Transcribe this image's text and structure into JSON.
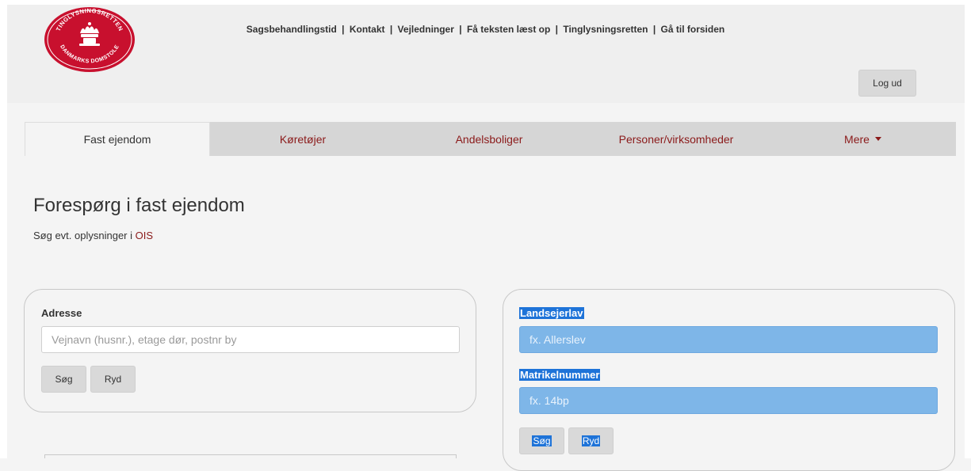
{
  "header": {
    "logo_text_top": "TINGLYSNINGSRETTEN",
    "logo_text_bottom": "DANMARKS DOMSTOLE",
    "links": [
      "Sagsbehandlingstid",
      "Kontakt",
      "Vejledninger",
      "Få teksten læst op",
      "Tinglysningsretten",
      "Gå til forsiden"
    ],
    "separator": "|",
    "logout_label": "Log ud"
  },
  "nav": {
    "tabs": [
      {
        "label": "Fast ejendom",
        "active": true
      },
      {
        "label": "Køretøjer",
        "active": false
      },
      {
        "label": "Andelsboliger",
        "active": false
      },
      {
        "label": "Personer/virksomheder",
        "active": false
      },
      {
        "label": "Mere",
        "active": false,
        "dropdown": true
      }
    ]
  },
  "main": {
    "title": "Forespørg i fast ejendom",
    "subtitle_prefix": "Søg evt. oplysninger i ",
    "subtitle_link": "OIS"
  },
  "address_panel": {
    "label": "Adresse",
    "input_placeholder": "Vejnavn (husnr.), etage dør, postnr by",
    "search_label": "Søg",
    "clear_label": "Ryd"
  },
  "cadastre_panel": {
    "district_label": "Landsejerlav",
    "district_placeholder": "fx. Allerslev",
    "number_label": "Matrikelnummer",
    "number_placeholder": "fx. 14bp",
    "search_label": "Søg",
    "clear_label": "Ryd"
  },
  "colors": {
    "brand_red": "#8b1a1a",
    "logo_red": "#c8102e",
    "selection_blue": "#1e73d8",
    "selection_input": "#7eb6e8"
  }
}
